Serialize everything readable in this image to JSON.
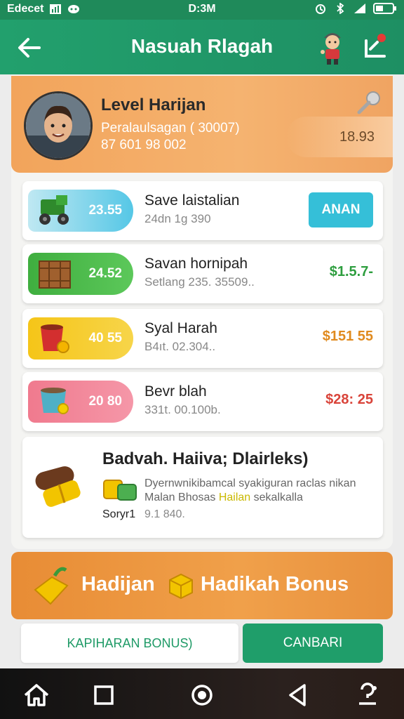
{
  "status_bar": {
    "carrier": "Edecet",
    "time": "D:3M"
  },
  "app_bar": {
    "title": "Nasuah Rlagah",
    "icons": [
      "back-arrow-icon",
      "avatar-icon",
      "share-icon"
    ]
  },
  "level_card": {
    "name": "Level Harijan",
    "subtitle": "Peralaulsagan ( 30007)",
    "id_number": "87 601 98 002",
    "score": "18.93"
  },
  "rows": [
    {
      "pill_value": "23.55",
      "title": "Save laistalian",
      "subtitle": "24dn 1g 390",
      "action_label": "ANAN",
      "icon": "tractor-icon"
    },
    {
      "pill_value": "24.52",
      "title": "Savan hornipah",
      "subtitle": "Setlang 235. 35509..",
      "price": "$1.5.7-",
      "icon": "crate-icon"
    },
    {
      "pill_value": "40 55",
      "title": "Syal Harah",
      "subtitle": "B4ıt. 02.304..",
      "price": "$151 55",
      "icon": "cup-icon"
    },
    {
      "pill_value": "20 80",
      "title": "Bevr blah",
      "subtitle": "331t. 00.100b.",
      "price": "$28: 25",
      "icon": "pot-icon"
    }
  ],
  "bundle": {
    "title": "Badvah. Haiiva; Dlairleks)",
    "desc_line1": "Dyernwnikibamcal syakiguran raclas nikan",
    "desc_line2_prefix": "Malan Bhosas ",
    "desc_line2_highlight": "Hailan",
    "desc_line2_suffix": " sekalkalla",
    "tag_label": "Soryr1",
    "tag_value": "9.1 840."
  },
  "bonus_banner": {
    "text1": "Hadijan",
    "text2": "Hadikah Bonus"
  },
  "buttons": {
    "secondary_label": "KAPIHARAN BONUS)",
    "primary_label": "CANBARI"
  },
  "colors": {
    "primary_green": "#1f9e6a",
    "orange": "#f0a04a",
    "price_green": "#2e9e3f",
    "price_orange": "#e08a1e",
    "price_red": "#d9443a",
    "accent_cyan": "#35bfd8"
  }
}
